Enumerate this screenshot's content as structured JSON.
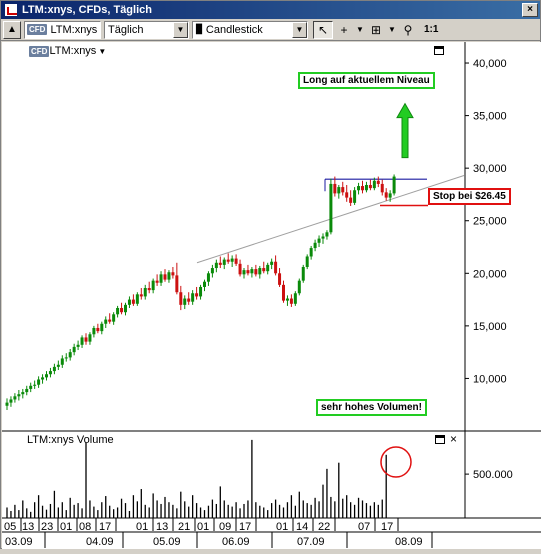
{
  "window": {
    "title": "LTM:xnys, CFDs, Täglich",
    "close_label": "×"
  },
  "toolbar": {
    "symbol_badge": "CFD",
    "symbol_value": "LTM:xnys",
    "period_value": "Täglich",
    "chart_type_value": "Candlestick",
    "ratio_label": "1:1"
  },
  "main_pane": {
    "badge": "CFD",
    "legend": "LTM:xnys",
    "y_ticks": [
      "40,000",
      "35,000",
      "30,000",
      "25,000",
      "20,000",
      "15,000",
      "10,000"
    ],
    "annotations": {
      "long": "Long auf aktuellem Niveau",
      "stop": "Stop bei $26.45",
      "volume": "sehr hohes Volumen!"
    }
  },
  "volume_pane": {
    "legend": "LTM:xnys Volume",
    "y_tick": "500.000",
    "close_label": "×"
  },
  "x_axis": {
    "days": [
      "05",
      "13",
      "23",
      "01",
      "08",
      "17",
      "01",
      "13",
      "21",
      "01",
      "09",
      "17",
      "01",
      "14",
      "22",
      "07",
      "17"
    ],
    "months": [
      "03.09",
      "04.09",
      "05.09",
      "06.09",
      "07.09",
      "08.09"
    ]
  },
  "colors": {
    "up_candle": "#0a8a0a",
    "down_candle": "#cc1111",
    "trendline": "#a0a0a0",
    "resistance": "#1a1aa0",
    "stop_line": "#e01010",
    "arrow": "#22cc22"
  },
  "chart_data": {
    "type": "candlestick",
    "y_range": [
      5000,
      42000
    ],
    "candles": [
      [
        7400,
        8100,
        7000,
        7700
      ],
      [
        7700,
        8300,
        7300,
        8000
      ],
      [
        8000,
        8600,
        7700,
        8300
      ],
      [
        8300,
        8900,
        7900,
        8500
      ],
      [
        8500,
        9000,
        8100,
        8700
      ],
      [
        8700,
        9300,
        8400,
        9000
      ],
      [
        9000,
        9600,
        8700,
        9300
      ],
      [
        9300,
        9800,
        9000,
        9400
      ],
      [
        9400,
        10200,
        9100,
        9900
      ],
      [
        9900,
        10400,
        9500,
        10100
      ],
      [
        10100,
        10700,
        9800,
        10400
      ],
      [
        10400,
        11000,
        10100,
        10700
      ],
      [
        10700,
        11400,
        10400,
        11100
      ],
      [
        11100,
        11700,
        10800,
        11300
      ],
      [
        11300,
        12200,
        11000,
        11900
      ],
      [
        11900,
        12400,
        11600,
        12000
      ],
      [
        12000,
        12800,
        11700,
        12500
      ],
      [
        12500,
        13300,
        12200,
        13000
      ],
      [
        13000,
        13600,
        12700,
        13200
      ],
      [
        13200,
        14100,
        12900,
        13900
      ],
      [
        13900,
        14300,
        13200,
        13500
      ],
      [
        13500,
        14400,
        13200,
        14200
      ],
      [
        14200,
        15000,
        13900,
        14800
      ],
      [
        14800,
        15200,
        14300,
        14500
      ],
      [
        14500,
        15400,
        14200,
        15200
      ],
      [
        15200,
        15900,
        14800,
        15600
      ],
      [
        15600,
        16200,
        15200,
        15400
      ],
      [
        15400,
        16300,
        15100,
        16100
      ],
      [
        16100,
        16900,
        15800,
        16700
      ],
      [
        16700,
        17200,
        16100,
        16300
      ],
      [
        16300,
        17200,
        16000,
        17000
      ],
      [
        17000,
        17800,
        16700,
        17500
      ],
      [
        17500,
        18000,
        16900,
        17100
      ],
      [
        17100,
        18200,
        16900,
        18000
      ],
      [
        18000,
        18600,
        17500,
        17800
      ],
      [
        17800,
        18900,
        17500,
        18600
      ],
      [
        18600,
        19200,
        18100,
        18400
      ],
      [
        18400,
        19500,
        18100,
        19300
      ],
      [
        19300,
        19900,
        18800,
        19100
      ],
      [
        19100,
        20200,
        18800,
        19900
      ],
      [
        19900,
        20400,
        19200,
        19400
      ],
      [
        19400,
        20300,
        19100,
        20100
      ],
      [
        20100,
        20600,
        19500,
        19800
      ],
      [
        19800,
        21000,
        18000,
        18200
      ],
      [
        18200,
        18800,
        16500,
        17000
      ],
      [
        17000,
        17900,
        16600,
        17600
      ],
      [
        17600,
        18200,
        17000,
        17300
      ],
      [
        17300,
        18400,
        17000,
        18100
      ],
      [
        18100,
        18700,
        17500,
        17800
      ],
      [
        17800,
        18900,
        17500,
        18700
      ],
      [
        18700,
        19400,
        18300,
        19200
      ],
      [
        19200,
        20200,
        18800,
        20000
      ],
      [
        20000,
        20800,
        19600,
        20500
      ],
      [
        20500,
        21300,
        20100,
        21000
      ],
      [
        21000,
        21600,
        20500,
        20800
      ],
      [
        20800,
        21500,
        20400,
        21300
      ],
      [
        21300,
        21900,
        20900,
        21100
      ],
      [
        21100,
        21700,
        20600,
        21400
      ],
      [
        21400,
        21800,
        20700,
        20900
      ],
      [
        20900,
        21300,
        19700,
        19900
      ],
      [
        19900,
        20500,
        19500,
        20300
      ],
      [
        20300,
        20800,
        19800,
        20000
      ],
      [
        20000,
        20600,
        19600,
        20400
      ],
      [
        20400,
        20800,
        19700,
        19900
      ],
      [
        19900,
        20700,
        19500,
        20500
      ],
      [
        20500,
        21100,
        20000,
        20200
      ],
      [
        20200,
        21000,
        19900,
        20800
      ],
      [
        20800,
        21400,
        20400,
        21100
      ],
      [
        21100,
        21700,
        19800,
        20000
      ],
      [
        20000,
        20500,
        18700,
        18900
      ],
      [
        18900,
        19300,
        17200,
        17400
      ],
      [
        17400,
        17900,
        16900,
        17600
      ],
      [
        17600,
        18000,
        16800,
        17100
      ],
      [
        17100,
        18300,
        16900,
        18100
      ],
      [
        18100,
        19500,
        17900,
        19300
      ],
      [
        19300,
        20800,
        19100,
        20600
      ],
      [
        20600,
        21800,
        20400,
        21600
      ],
      [
        21600,
        22600,
        21300,
        22400
      ],
      [
        22400,
        23200,
        22100,
        22900
      ],
      [
        22900,
        23600,
        22500,
        23300
      ],
      [
        23300,
        23800,
        22800,
        23500
      ],
      [
        23500,
        24100,
        23200,
        23900
      ],
      [
        23900,
        29000,
        23700,
        28500
      ],
      [
        28500,
        29200,
        27300,
        27600
      ],
      [
        27600,
        28400,
        27100,
        28200
      ],
      [
        28200,
        28700,
        27400,
        27700
      ],
      [
        27700,
        28400,
        26800,
        27200
      ],
      [
        27200,
        27900,
        26400,
        26700
      ],
      [
        26700,
        28200,
        26500,
        27900
      ],
      [
        27900,
        28600,
        27500,
        28300
      ],
      [
        28300,
        28800,
        27600,
        27900
      ],
      [
        27900,
        28700,
        27700,
        28400
      ],
      [
        28400,
        28900,
        27900,
        28100
      ],
      [
        28100,
        29100,
        27900,
        28800
      ],
      [
        28800,
        29200,
        28200,
        28500
      ],
      [
        28500,
        28900,
        27400,
        27700
      ],
      [
        27700,
        28100,
        26900,
        27200
      ],
      [
        27200,
        27900,
        26800,
        27600
      ],
      [
        27600,
        29400,
        27400,
        29200
      ]
    ],
    "volume_series": [
      120000,
      80000,
      150000,
      90000,
      200000,
      110000,
      70000,
      180000,
      260000,
      140000,
      95000,
      160000,
      310000,
      120000,
      180000,
      90000,
      230000,
      150000,
      170000,
      110000,
      860000,
      200000,
      130000,
      90000,
      180000,
      250000,
      140000,
      100000,
      120000,
      220000,
      170000,
      80000,
      260000,
      190000,
      330000,
      150000,
      120000,
      280000,
      200000,
      160000,
      240000,
      180000,
      150000,
      110000,
      300000,
      190000,
      130000,
      260000,
      170000,
      120000,
      90000,
      140000,
      210000,
      160000,
      360000,
      200000,
      150000,
      130000,
      180000,
      110000,
      160000,
      200000,
      890000,
      180000,
      140000,
      120000,
      90000,
      170000,
      210000,
      150000,
      120000,
      180000,
      260000,
      140000,
      300000,
      200000,
      170000,
      150000,
      230000,
      190000,
      380000,
      560000,
      240000,
      190000,
      630000,
      220000,
      260000,
      180000,
      150000,
      230000,
      200000,
      170000,
      140000,
      180000,
      150000,
      210000,
      720000
    ],
    "resistance_level": 28950,
    "stop_level": 26450,
    "volume_max": 900000
  }
}
